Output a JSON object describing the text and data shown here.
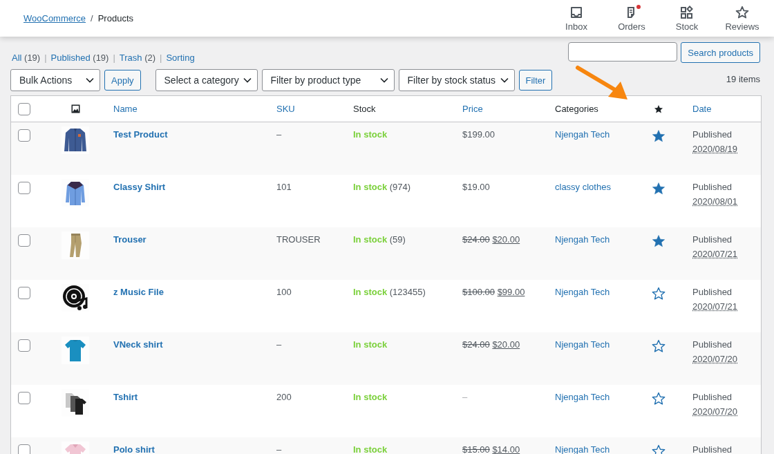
{
  "breadcrumb": {
    "parent": "WooCommerce",
    "separator": "/",
    "current": "Products"
  },
  "header_nav": [
    {
      "label": "Inbox",
      "kind": "inbox",
      "badge": false
    },
    {
      "label": "Orders",
      "kind": "orders",
      "badge": true
    },
    {
      "label": "Stock",
      "kind": "stock",
      "badge": false
    },
    {
      "label": "Reviews",
      "kind": "reviews",
      "badge": false
    }
  ],
  "views": [
    {
      "label": "All",
      "count": "(19)"
    },
    {
      "separator": "|",
      "label": "Published",
      "count": "(19)"
    },
    {
      "separator": "|",
      "label": "Trash",
      "count": "(2)"
    },
    {
      "separator": "|",
      "label": "Sorting"
    }
  ],
  "search": {
    "button": "Search products"
  },
  "toolbar": {
    "bulk_actions": "Bulk Actions",
    "apply": "Apply",
    "category": "Select a category",
    "product_type": "Filter by product type",
    "stock_status": "Filter by stock status",
    "filter": "Filter"
  },
  "item_count": "19 items",
  "table": {
    "select_all_checked": false,
    "columns": [
      {
        "label": "Name",
        "sortable": true
      },
      {
        "label": "SKU",
        "sortable": true
      },
      {
        "label": "Stock",
        "sortable": false
      },
      {
        "label": "Price",
        "sortable": true
      },
      {
        "label": "Categories",
        "sortable": false
      },
      {
        "label": "Date",
        "sortable": true
      }
    ],
    "rows": [
      {
        "checked": false,
        "name": "Test Product",
        "sku": "–",
        "stock": "In stock",
        "price": {
          "kind": "regular",
          "amount": "$199.00"
        },
        "category": "Njengah Tech",
        "featured": true,
        "status": "Published",
        "date": "2020/08/19"
      },
      {
        "checked": false,
        "name": "Classy Shirt",
        "sku": "101",
        "stock": "In stock",
        "stock_count": "(974)",
        "price": {
          "kind": "regular",
          "amount": "$19.00"
        },
        "category": "classy clothes",
        "featured": true,
        "status": "Published",
        "date": "2020/08/01"
      },
      {
        "checked": false,
        "name": "Trouser",
        "sku": "TROUSER",
        "stock": "In stock",
        "stock_count": "(59)",
        "price": {
          "kind": "sale",
          "old": "$24.00",
          "amount": "$20.00"
        },
        "category": "Njengah Tech",
        "featured": true,
        "status": "Published",
        "date": "2020/07/21"
      },
      {
        "checked": false,
        "name": "z Music File",
        "sku": "100",
        "stock": "In stock",
        "stock_count": "(123455)",
        "price": {
          "kind": "sale",
          "old": "$100.00",
          "amount": "$99.00"
        },
        "category": "Njengah Tech",
        "featured": false,
        "status": "Published",
        "date": "2020/07/21"
      },
      {
        "checked": false,
        "name": "VNeck shirt",
        "sku": "–",
        "stock": "In stock",
        "price": {
          "kind": "sale",
          "old": "$24.00",
          "amount": "$20.00"
        },
        "category": "Njengah Tech",
        "featured": false,
        "status": "Published",
        "date": "2020/07/20"
      },
      {
        "checked": false,
        "name": "Tshirt",
        "sku": "200",
        "stock": "In stock",
        "price": {
          "kind": "none",
          "amount": "–"
        },
        "category": "Njengah Tech",
        "featured": false,
        "status": "Published",
        "date": "2020/07/20"
      },
      {
        "checked": false,
        "name": "Polo shirt",
        "sku": "–",
        "stock": "In stock",
        "price": {
          "kind": "sale",
          "old": "$15.00",
          "amount": "$14.00"
        },
        "category": "Njengah Tech",
        "featured": false,
        "status": "Published"
      }
    ]
  }
}
